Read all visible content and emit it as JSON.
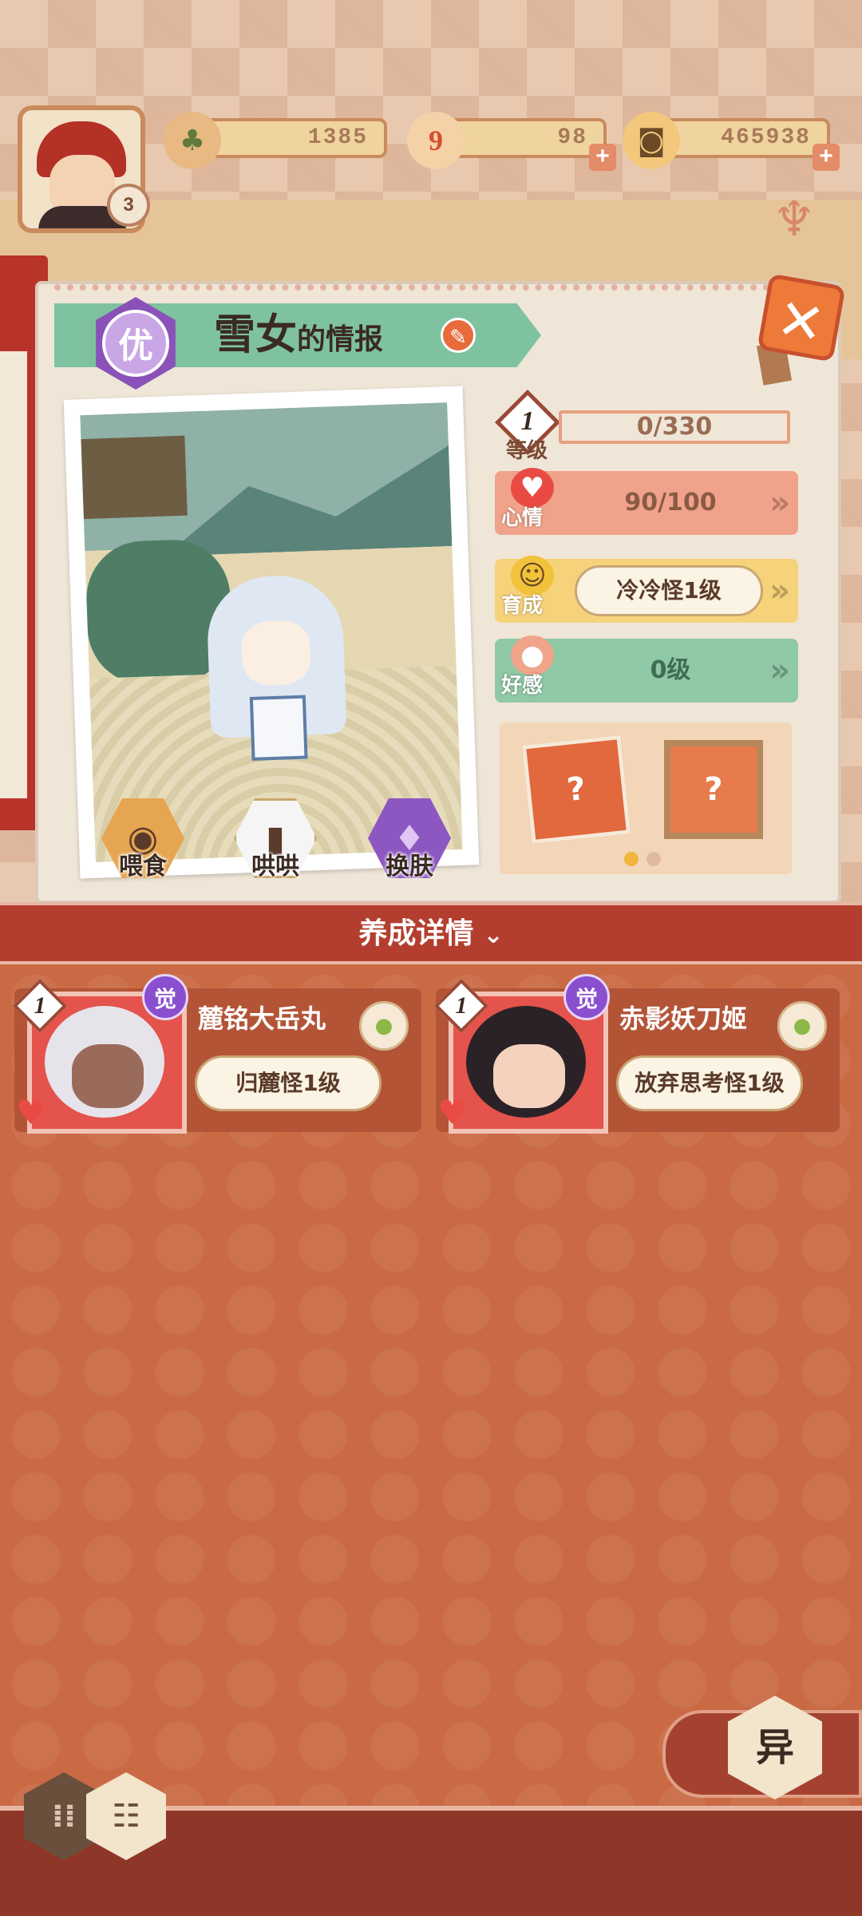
{
  "header": {
    "player_level": "3",
    "resources": [
      {
        "icon": "pine-icon",
        "value": "1385"
      },
      {
        "icon": "jade-icon",
        "value": "98",
        "has_plus": true
      },
      {
        "icon": "coin-icon",
        "value": "465938",
        "has_plus": true
      }
    ]
  },
  "character": {
    "rank": "优",
    "name": "雪女",
    "title_suffix": "的情报"
  },
  "actions": {
    "feed": "喂食",
    "coax": "哄哄",
    "skin": "换肤"
  },
  "stats": {
    "level": {
      "num": "1",
      "label": "等级",
      "exp": "0/330"
    },
    "mood": {
      "label": "心情",
      "value": "90/100"
    },
    "training": {
      "label": "育成",
      "value": "冷冷怪1级"
    },
    "favor": {
      "label": "好感",
      "value": "0级"
    }
  },
  "gifts": {
    "unknown": "?",
    "page_count": 2,
    "current_page": 1
  },
  "details": {
    "title": "养成详情",
    "monsters": [
      {
        "level": "1",
        "awaken": "觉",
        "name": "麓铭大岳丸",
        "status": "归麓怪1级"
      },
      {
        "level": "1",
        "awaken": "觉",
        "name": "赤影妖刀姬",
        "status": "放弃思考怪1级"
      }
    ]
  },
  "bottom": {
    "rare_label": "异"
  },
  "colors": {
    "accent": "#c96a44",
    "ribbon": "#7fc2a0",
    "mood": "#f0a38a",
    "training": "#f6d27a",
    "favor": "#8fc9a5",
    "rank": "#8a52b8"
  }
}
